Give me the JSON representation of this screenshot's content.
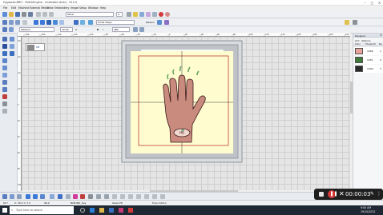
{
  "window": {
    "title": "Hygloves.BRO - StitchEngine - Unlimited (trial) - V12.0",
    "min": "–",
    "max": "▢",
    "close": "✕"
  },
  "menu": [
    "File",
    "Edit",
    "Machine",
    "External Media",
    "View",
    "Embroidery",
    "Image",
    "Setup",
    "Window",
    "Help"
  ],
  "toolbar1": {
    "style_value": "Other",
    "pen_value": "0"
  },
  "toolbar2": {
    "fill_value": "Small Steps",
    "pattern_label": "Pattern"
  },
  "toolbar3": {
    "thread_value": "Madeira",
    "size_value": "10.00",
    "auto_label": "A",
    "bold_label": "B",
    "italic_label": "I",
    "abc_label": "ABC"
  },
  "ruler_labels": [
    "-180",
    "-160",
    "-140",
    "-120",
    "-100",
    "-80",
    "-60",
    "-40",
    "-20",
    "0",
    "20",
    "40",
    "60",
    "80",
    "100",
    "120",
    "140",
    "160",
    "180",
    "200",
    "220"
  ],
  "ruler_left_labels": [
    "-80",
    "-60",
    "-40",
    "-20",
    "0",
    "20",
    "40",
    "60",
    "80",
    "100"
  ],
  "design": {
    "badge_text": "HB"
  },
  "colors": {
    "glove": "#c98b7e",
    "outline": "#3a1a1a",
    "accent": "#6ba36b",
    "hoop_fill": "#fffdd0",
    "hoop_border": "#9aa0a6",
    "redline": "#c23b3b"
  },
  "right_panel": {
    "title": "Designer",
    "tabs": [
      "Ord",
      "Options"
    ],
    "headers": [
      "Color",
      "Thread ID",
      "No."
    ],
    "rows": [
      {
        "swatch": "#e8a39c",
        "thread": "1066",
        "no": "1"
      },
      {
        "swatch": "#3f7a3a",
        "thread": "1051",
        "no": "2"
      },
      {
        "swatch": "#2a2a2a",
        "thread": "1000",
        "no": "3"
      }
    ]
  },
  "status": {
    "left": "617",
    "coords": "X: 30.4 Y: 3.3",
    "zoom": "96.0",
    "mode": "BCB.INK_Svg",
    "stitch": "Glass Fill",
    "color": "Pure Cotton"
  },
  "recorder": {
    "time": "00:00:03"
  },
  "taskbar": {
    "search_placeholder": "Type here to search",
    "clock_time": "9:00 AM",
    "clock_date": "19/10/2022"
  }
}
